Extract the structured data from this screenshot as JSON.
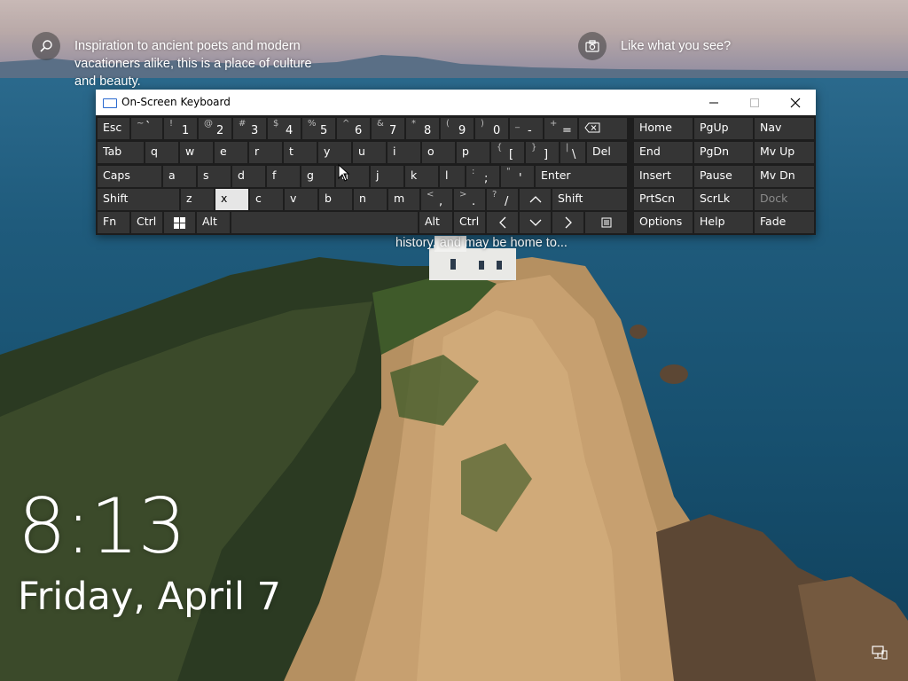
{
  "spotlight": {
    "info_text": "Inspiration to ancient poets and modern vacationers alike, this is a place of culture and beauty.",
    "info_line1": "Inspiration to ancient poets and modern",
    "info_line2": "vacationers alike, this is a place of culture",
    "info_line3": "and beauty.",
    "like_text": "Like what you see?",
    "overlay_text": "history, and may be home to..."
  },
  "lock": {
    "time": "8:13",
    "date": "Friday, April 7"
  },
  "osk": {
    "title": "On-Screen Keyboard",
    "row1": [
      {
        "label": "Esc"
      },
      {
        "sub": "~",
        "low": "`"
      },
      {
        "sub": "!",
        "low": "1"
      },
      {
        "sub": "@",
        "low": "2"
      },
      {
        "sub": "#",
        "low": "3"
      },
      {
        "sub": "$",
        "low": "4"
      },
      {
        "sub": "%",
        "low": "5"
      },
      {
        "sub": "^",
        "low": "6"
      },
      {
        "sub": "&",
        "low": "7"
      },
      {
        "sub": "*",
        "low": "8"
      },
      {
        "sub": "(",
        "low": "9"
      },
      {
        "sub": ")",
        "low": "0"
      },
      {
        "sub": "_",
        "low": "-"
      },
      {
        "sub": "+",
        "low": "="
      }
    ],
    "row2": [
      "Tab",
      "q",
      "w",
      "e",
      "r",
      "t",
      "y",
      "u",
      "i",
      "o",
      "p"
    ],
    "row2_brackets": [
      {
        "sub": "{",
        "low": "["
      },
      {
        "sub": "}",
        "low": "]"
      },
      {
        "sub": "|",
        "low": "\\"
      }
    ],
    "row2_del": "Del",
    "row3": [
      "Caps",
      "a",
      "s",
      "d",
      "f",
      "g",
      "h",
      "j",
      "k",
      "l"
    ],
    "row3_punct": [
      {
        "sub": ":",
        "low": ";"
      },
      {
        "sub": "\"",
        "low": "'"
      }
    ],
    "row3_enter": "Enter",
    "row4": [
      "Shift",
      "z",
      "x",
      "c",
      "v",
      "b",
      "n",
      "m"
    ],
    "row4_punct": [
      {
        "sub": "<",
        "low": ","
      },
      {
        "sub": ">",
        "low": "."
      },
      {
        "sub": "?",
        "low": "/"
      }
    ],
    "row4_shift_r": "Shift",
    "row5": {
      "fn": "Fn",
      "ctrl": "Ctrl",
      "alt": "Alt",
      "alt_r": "Alt",
      "ctrl_r": "Ctrl"
    },
    "nav": {
      "home": "Home",
      "pgup": "PgUp",
      "nav": "Nav",
      "end": "End",
      "pgdn": "PgDn",
      "mvup": "Mv Up",
      "insert": "Insert",
      "pause": "Pause",
      "mvdn": "Mv Dn",
      "prtscn": "PrtScn",
      "scrlk": "ScrLk",
      "dock": "Dock",
      "options": "Options",
      "help": "Help",
      "fade": "Fade"
    },
    "selected_key": "x"
  }
}
